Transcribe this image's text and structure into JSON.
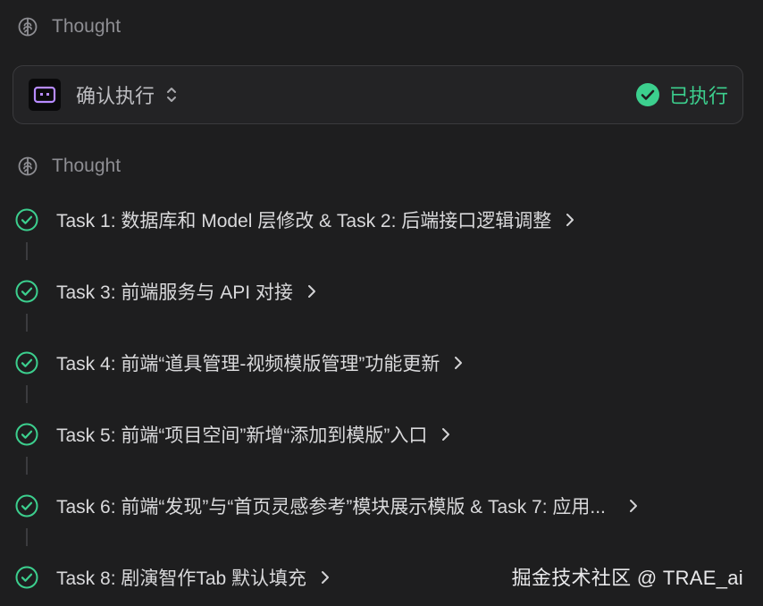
{
  "thought_label": "Thought",
  "confirm_card": {
    "title": "确认执行",
    "status": "已执行"
  },
  "tasks": [
    {
      "label": "Task 1: 数据库和 Model 层修改 & Task 2: 后端接口逻辑调整"
    },
    {
      "label": "Task 3: 前端服务与 API 对接"
    },
    {
      "label": "Task 4: 前端“道具管理-视频模版管理”功能更新"
    },
    {
      "label": "Task 5: 前端“项目空间”新增“添加到模版”入口"
    },
    {
      "label": "Task 6: 前端“发现”与“首页灵感参考”模块展示模版 & Task 7: 应用..."
    },
    {
      "label": "Task 8: 剧演智作Tab 默认填充"
    }
  ],
  "watermark": "掘金技术社区 @ TRAE_ai",
  "colors": {
    "background": "#1e1e1f",
    "success": "#3ccf8e",
    "muted": "#8e8e93",
    "bot_accent": "#b78bff"
  }
}
